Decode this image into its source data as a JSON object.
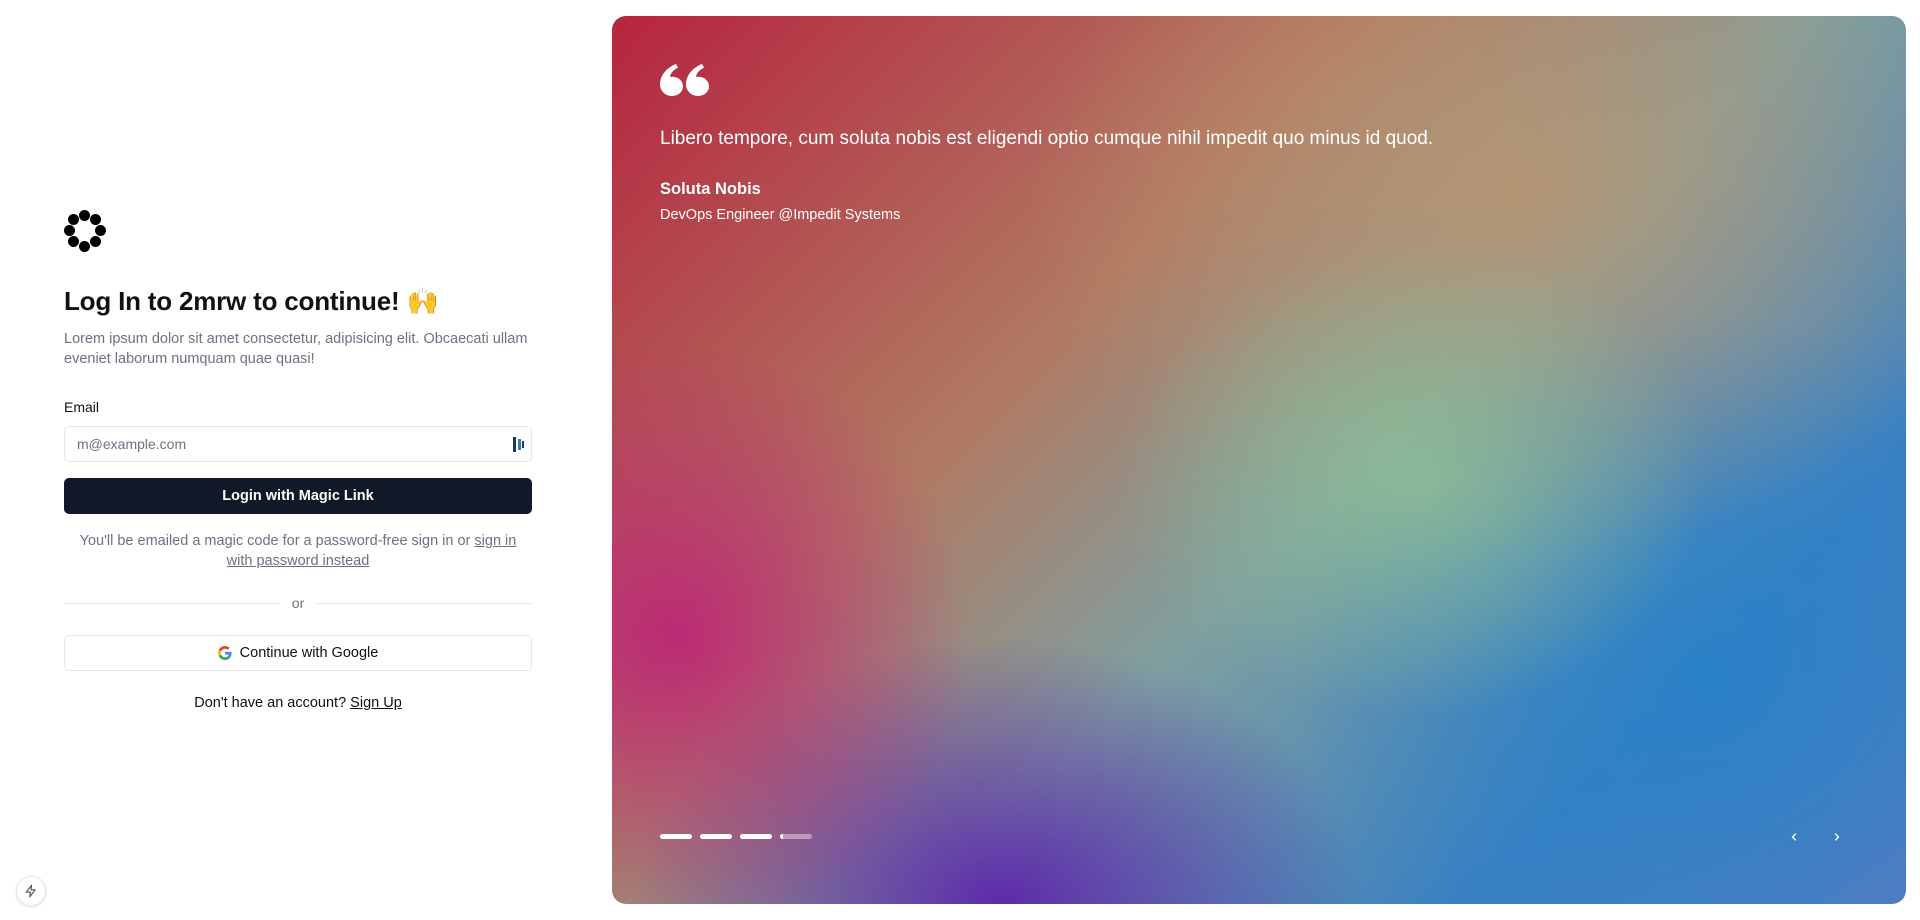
{
  "login": {
    "logo_icon": "dotted-circle-logo",
    "title": "Log In to 2mrw to continue! 🙌",
    "subtitle": "Lorem ipsum dolor sit amet consectetur, adipisicing elit. Obcaecati ullam eveniet laborum numquam quae quasi!",
    "email_label": "Email",
    "email_placeholder": "m@example.com",
    "email_value": "",
    "password_manager_icon": "password-manager-icon",
    "primary_button": "Login with Magic Link",
    "note_text": "You'll be emailed a magic code for a password-free sign in or ",
    "note_link": "sign in with password instead",
    "divider_text": "or",
    "google_button": "Continue with Google",
    "google_icon": "google-icon",
    "signup_text": "Don't have an account? ",
    "signup_link": "Sign Up"
  },
  "testimonial": {
    "quote_icon": "quote-icon",
    "quote": "Libero tempore, cum soluta nobis est eligendi optio cumque nihil impedit quo minus id quod.",
    "author": "Soluta Nobis",
    "role": "DevOps Engineer @Impedit Systems",
    "slide_count": 4,
    "current_slide": 4,
    "prev_icon": "chevron-left-icon",
    "next_icon": "chevron-right-icon"
  },
  "dev_tools_icon": "lightning-icon"
}
